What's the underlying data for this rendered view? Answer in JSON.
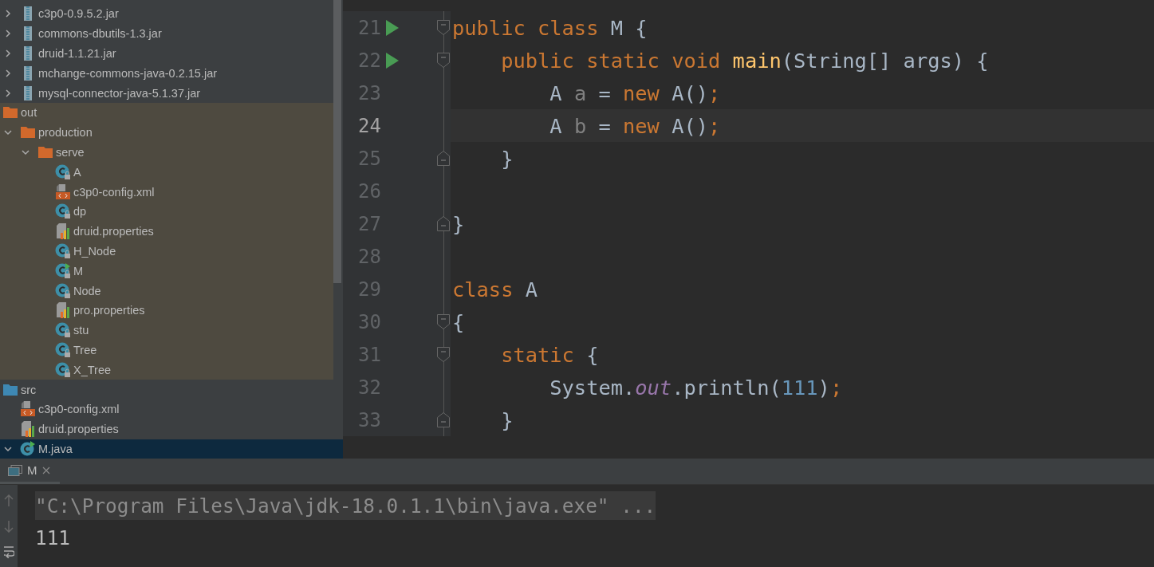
{
  "project_tree": {
    "libraries": [
      {
        "label": "c3p0-0.9.5.2.jar",
        "kind": "jar",
        "expanded": false
      },
      {
        "label": "commons-dbutils-1.3.jar",
        "kind": "jar",
        "expanded": false
      },
      {
        "label": "druid-1.1.21.jar",
        "kind": "jar",
        "expanded": false
      },
      {
        "label": "mchange-commons-java-0.2.15.jar",
        "kind": "jar",
        "expanded": false
      },
      {
        "label": "mysql-connector-java-5.1.37.jar",
        "kind": "jar",
        "expanded": false
      }
    ],
    "items": [
      {
        "label": "out",
        "kind": "folder-excluded",
        "excluded": true,
        "selected": false,
        "children": [
          {
            "label": "production",
            "kind": "folder-excluded",
            "expanded": true,
            "selected": false,
            "children": [
              {
                "label": "serve",
                "kind": "folder-excluded",
                "expanded": true,
                "selected": false,
                "children": [
                  {
                    "label": "A",
                    "kind": "class",
                    "selected": false
                  },
                  {
                    "label": "c3p0-config.xml",
                    "kind": "xml",
                    "selected": false
                  },
                  {
                    "label": "dp",
                    "kind": "class",
                    "selected": false
                  },
                  {
                    "label": "druid.properties",
                    "kind": "properties",
                    "selected": false
                  },
                  {
                    "label": "H_Node",
                    "kind": "class",
                    "selected": false
                  },
                  {
                    "label": "M",
                    "kind": "class-main",
                    "selected": false
                  },
                  {
                    "label": "Node",
                    "kind": "class",
                    "selected": false
                  },
                  {
                    "label": "pro.properties",
                    "kind": "properties",
                    "selected": false
                  },
                  {
                    "label": "stu",
                    "kind": "class",
                    "selected": false
                  },
                  {
                    "label": "Tree",
                    "kind": "class",
                    "selected": false
                  },
                  {
                    "label": "X_Tree",
                    "kind": "class",
                    "selected": false
                  }
                ]
              }
            ]
          }
        ]
      },
      {
        "label": "src",
        "kind": "folder-source",
        "excluded": false,
        "selected": false,
        "children": [
          {
            "label": "c3p0-config.xml",
            "kind": "xml",
            "selected": false
          },
          {
            "label": "druid.properties",
            "kind": "properties",
            "selected": false
          },
          {
            "label": "M.java",
            "kind": "java-main",
            "expanded": true,
            "selected": true
          }
        ]
      }
    ]
  },
  "editor": {
    "lines": [
      {
        "number": "21",
        "run": true,
        "fold_start": true,
        "fold_end": false,
        "current": false,
        "tokens": [
          {
            "text": "public class ",
            "kind": "keyword"
          },
          {
            "text": "M {",
            "kind": "plain"
          }
        ]
      },
      {
        "number": "22",
        "run": true,
        "fold_start": true,
        "fold_end": false,
        "current": false,
        "tokens": [
          {
            "text": "    public static void ",
            "kind": "keyword"
          },
          {
            "text": "main",
            "kind": "method"
          },
          {
            "text": "(String[] args) {",
            "kind": "plain"
          }
        ]
      },
      {
        "number": "23",
        "run": false,
        "fold_start": false,
        "fold_end": false,
        "current": false,
        "tokens": [
          {
            "text": "        A ",
            "kind": "plain"
          },
          {
            "text": "a",
            "kind": "unused"
          },
          {
            "text": " = ",
            "kind": "plain"
          },
          {
            "text": "new ",
            "kind": "keyword"
          },
          {
            "text": "A()",
            "kind": "plain"
          },
          {
            "text": ";",
            "kind": "keyword"
          }
        ]
      },
      {
        "number": "24",
        "run": false,
        "fold_start": false,
        "fold_end": false,
        "current": true,
        "tokens": [
          {
            "text": "        A ",
            "kind": "plain"
          },
          {
            "text": "b",
            "kind": "unused"
          },
          {
            "text": " = ",
            "kind": "plain"
          },
          {
            "text": "new ",
            "kind": "keyword"
          },
          {
            "text": "A()",
            "kind": "plain"
          },
          {
            "text": ";",
            "kind": "keyword"
          }
        ]
      },
      {
        "number": "25",
        "run": false,
        "fold_start": false,
        "fold_end": true,
        "current": false,
        "tokens": [
          {
            "text": "    }",
            "kind": "plain"
          }
        ]
      },
      {
        "number": "26",
        "run": false,
        "fold_start": false,
        "fold_end": false,
        "current": false
      },
      {
        "number": "27",
        "run": false,
        "fold_start": false,
        "fold_end": true,
        "current": false,
        "tokens": [
          {
            "text": "}",
            "kind": "plain"
          }
        ]
      },
      {
        "number": "28",
        "run": false,
        "fold_start": false,
        "fold_end": false,
        "current": false
      },
      {
        "number": "29",
        "run": false,
        "fold_start": false,
        "fold_end": false,
        "current": false,
        "tokens": [
          {
            "text": "class ",
            "kind": "keyword"
          },
          {
            "text": "A",
            "kind": "plain"
          }
        ]
      },
      {
        "number": "30",
        "run": false,
        "fold_start": true,
        "fold_end": false,
        "current": false,
        "tokens": [
          {
            "text": "{",
            "kind": "plain"
          }
        ]
      },
      {
        "number": "31",
        "run": false,
        "fold_start": true,
        "fold_end": false,
        "current": false,
        "tokens": [
          {
            "text": "    static ",
            "kind": "keyword"
          },
          {
            "text": "{",
            "kind": "plain"
          }
        ]
      },
      {
        "number": "32",
        "run": false,
        "fold_start": false,
        "fold_end": false,
        "current": false,
        "tokens": [
          {
            "text": "        System.",
            "kind": "plain"
          },
          {
            "text": "out",
            "kind": "static-field"
          },
          {
            "text": ".println(",
            "kind": "plain"
          },
          {
            "text": "111",
            "kind": "number"
          },
          {
            "text": ")",
            "kind": "plain"
          },
          {
            "text": ";",
            "kind": "keyword"
          }
        ]
      },
      {
        "number": "33",
        "run": false,
        "fold_start": false,
        "fold_end": true,
        "current": false,
        "tokens": [
          {
            "text": "    }",
            "kind": "plain"
          }
        ]
      }
    ]
  },
  "run_panel": {
    "tabs": [
      {
        "label": "M",
        "selected": true
      }
    ],
    "lines": [
      {
        "text": "\"C:\\Program Files\\Java\\jdk-18.0.1.1\\bin\\java.exe\" ...",
        "kind": "command"
      },
      {
        "text": "111",
        "kind": "output"
      }
    ]
  }
}
